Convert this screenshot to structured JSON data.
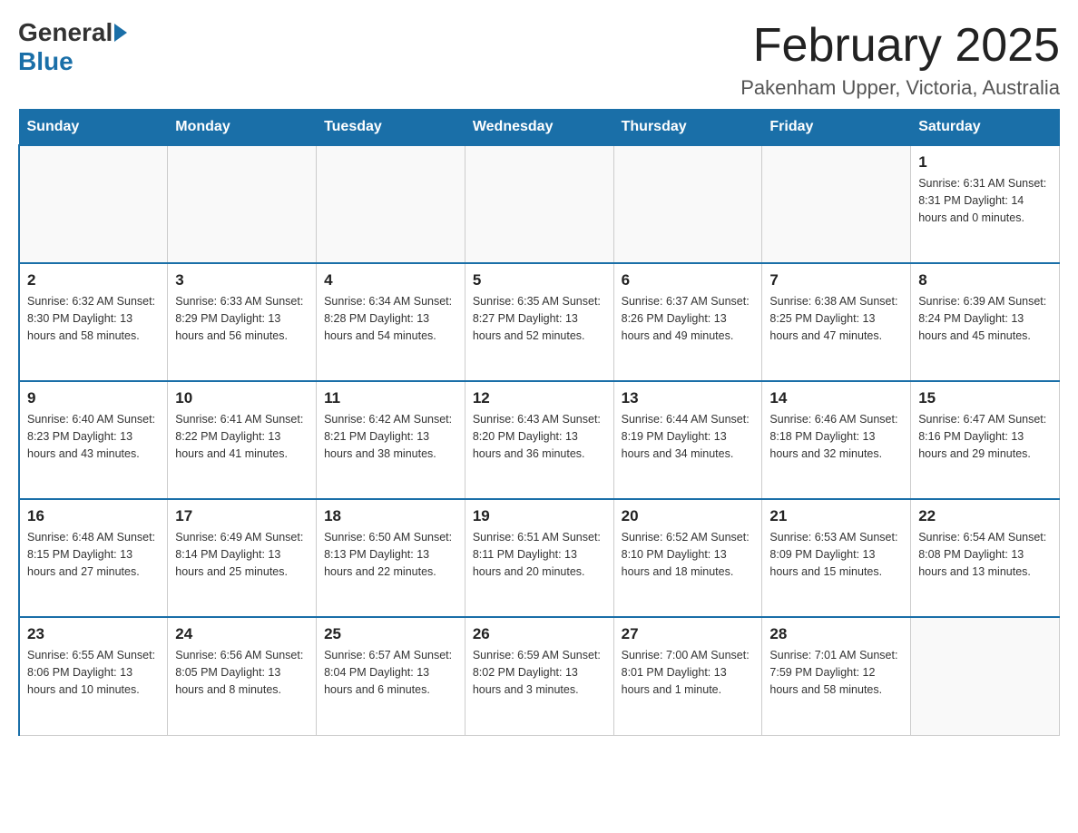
{
  "header": {
    "logo_general": "General",
    "logo_blue": "Blue",
    "month_title": "February 2025",
    "location": "Pakenham Upper, Victoria, Australia"
  },
  "calendar": {
    "days_of_week": [
      "Sunday",
      "Monday",
      "Tuesday",
      "Wednesday",
      "Thursday",
      "Friday",
      "Saturday"
    ],
    "weeks": [
      [
        {
          "day": "",
          "info": ""
        },
        {
          "day": "",
          "info": ""
        },
        {
          "day": "",
          "info": ""
        },
        {
          "day": "",
          "info": ""
        },
        {
          "day": "",
          "info": ""
        },
        {
          "day": "",
          "info": ""
        },
        {
          "day": "1",
          "info": "Sunrise: 6:31 AM\nSunset: 8:31 PM\nDaylight: 14 hours and 0 minutes."
        }
      ],
      [
        {
          "day": "2",
          "info": "Sunrise: 6:32 AM\nSunset: 8:30 PM\nDaylight: 13 hours and 58 minutes."
        },
        {
          "day": "3",
          "info": "Sunrise: 6:33 AM\nSunset: 8:29 PM\nDaylight: 13 hours and 56 minutes."
        },
        {
          "day": "4",
          "info": "Sunrise: 6:34 AM\nSunset: 8:28 PM\nDaylight: 13 hours and 54 minutes."
        },
        {
          "day": "5",
          "info": "Sunrise: 6:35 AM\nSunset: 8:27 PM\nDaylight: 13 hours and 52 minutes."
        },
        {
          "day": "6",
          "info": "Sunrise: 6:37 AM\nSunset: 8:26 PM\nDaylight: 13 hours and 49 minutes."
        },
        {
          "day": "7",
          "info": "Sunrise: 6:38 AM\nSunset: 8:25 PM\nDaylight: 13 hours and 47 minutes."
        },
        {
          "day": "8",
          "info": "Sunrise: 6:39 AM\nSunset: 8:24 PM\nDaylight: 13 hours and 45 minutes."
        }
      ],
      [
        {
          "day": "9",
          "info": "Sunrise: 6:40 AM\nSunset: 8:23 PM\nDaylight: 13 hours and 43 minutes."
        },
        {
          "day": "10",
          "info": "Sunrise: 6:41 AM\nSunset: 8:22 PM\nDaylight: 13 hours and 41 minutes."
        },
        {
          "day": "11",
          "info": "Sunrise: 6:42 AM\nSunset: 8:21 PM\nDaylight: 13 hours and 38 minutes."
        },
        {
          "day": "12",
          "info": "Sunrise: 6:43 AM\nSunset: 8:20 PM\nDaylight: 13 hours and 36 minutes."
        },
        {
          "day": "13",
          "info": "Sunrise: 6:44 AM\nSunset: 8:19 PM\nDaylight: 13 hours and 34 minutes."
        },
        {
          "day": "14",
          "info": "Sunrise: 6:46 AM\nSunset: 8:18 PM\nDaylight: 13 hours and 32 minutes."
        },
        {
          "day": "15",
          "info": "Sunrise: 6:47 AM\nSunset: 8:16 PM\nDaylight: 13 hours and 29 minutes."
        }
      ],
      [
        {
          "day": "16",
          "info": "Sunrise: 6:48 AM\nSunset: 8:15 PM\nDaylight: 13 hours and 27 minutes."
        },
        {
          "day": "17",
          "info": "Sunrise: 6:49 AM\nSunset: 8:14 PM\nDaylight: 13 hours and 25 minutes."
        },
        {
          "day": "18",
          "info": "Sunrise: 6:50 AM\nSunset: 8:13 PM\nDaylight: 13 hours and 22 minutes."
        },
        {
          "day": "19",
          "info": "Sunrise: 6:51 AM\nSunset: 8:11 PM\nDaylight: 13 hours and 20 minutes."
        },
        {
          "day": "20",
          "info": "Sunrise: 6:52 AM\nSunset: 8:10 PM\nDaylight: 13 hours and 18 minutes."
        },
        {
          "day": "21",
          "info": "Sunrise: 6:53 AM\nSunset: 8:09 PM\nDaylight: 13 hours and 15 minutes."
        },
        {
          "day": "22",
          "info": "Sunrise: 6:54 AM\nSunset: 8:08 PM\nDaylight: 13 hours and 13 minutes."
        }
      ],
      [
        {
          "day": "23",
          "info": "Sunrise: 6:55 AM\nSunset: 8:06 PM\nDaylight: 13 hours and 10 minutes."
        },
        {
          "day": "24",
          "info": "Sunrise: 6:56 AM\nSunset: 8:05 PM\nDaylight: 13 hours and 8 minutes."
        },
        {
          "day": "25",
          "info": "Sunrise: 6:57 AM\nSunset: 8:04 PM\nDaylight: 13 hours and 6 minutes."
        },
        {
          "day": "26",
          "info": "Sunrise: 6:59 AM\nSunset: 8:02 PM\nDaylight: 13 hours and 3 minutes."
        },
        {
          "day": "27",
          "info": "Sunrise: 7:00 AM\nSunset: 8:01 PM\nDaylight: 13 hours and 1 minute."
        },
        {
          "day": "28",
          "info": "Sunrise: 7:01 AM\nSunset: 7:59 PM\nDaylight: 12 hours and 58 minutes."
        },
        {
          "day": "",
          "info": ""
        }
      ]
    ]
  }
}
